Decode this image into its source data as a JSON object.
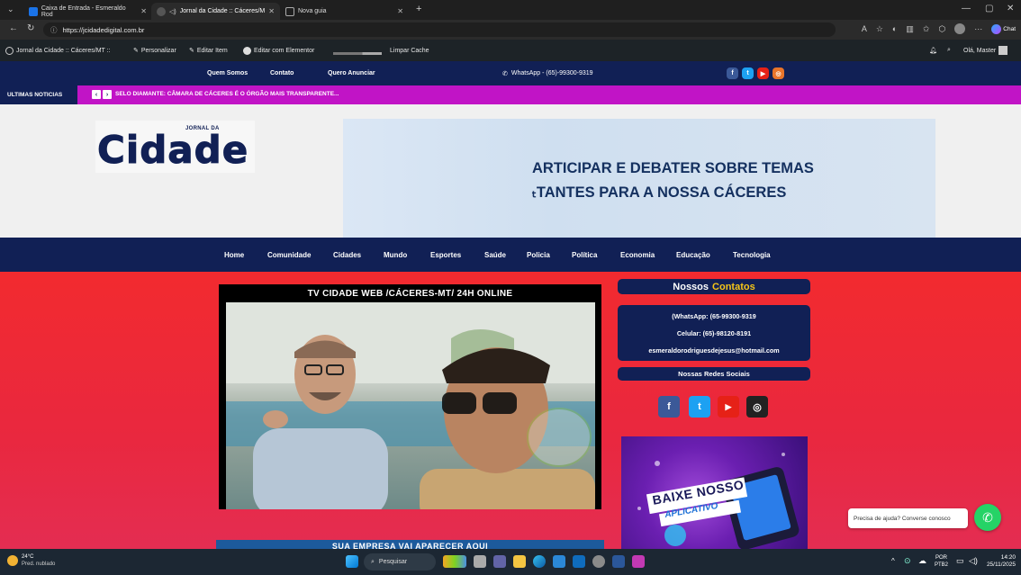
{
  "browser": {
    "tabs": [
      {
        "title": "Caixa de Entrada - Esmeraldo Rod",
        "active": false
      },
      {
        "title": "Jornal da Cidade :: Cáceres/M",
        "active": true
      },
      {
        "title": "Nova guia",
        "active": false
      }
    ],
    "url": "https://jcidadedigital.com.br",
    "profile_label": "Chat"
  },
  "wp_admin": {
    "site_name": "Jornal da Cidade :: Cáceres/MT ::",
    "customize": "Personalizar",
    "edit_item": "Editar Item",
    "edit_elementor": "Editar com Elementor",
    "clear_cache": "Limpar Cache",
    "greeting": "Olá, Master"
  },
  "topbar": {
    "links": [
      "Quem Somos",
      "Contato",
      "Quero Anunciar"
    ],
    "whatsapp": "WhatsApp - (65)-99300-9319"
  },
  "ticker": {
    "label": "ULTIMAS NOTICIAS",
    "headline": "SELO DIAMANTE: CÂMARA DE CÁCERES É O ÓRGÃO MAIS TRANSPARENTE..."
  },
  "header": {
    "logo_small": "JORNAL DA",
    "logo_big": "Cidade",
    "banner_line1": "ARTICIPAR E DEBATER SOBRE TEMAS",
    "banner_line2": "ₜTANTES PARA A NOSSA CÁCERES"
  },
  "main_nav": [
    "Home",
    "Comunidade",
    "Cidades",
    "Mundo",
    "Esportes",
    "Saúde",
    "Policia",
    "Política",
    "Economia",
    "Educação",
    "Tecnologia"
  ],
  "video": {
    "title": "TV CIDADE WEB /CÁCERES-MT/ 24H ONLINE"
  },
  "contacts": {
    "heading_white": "Nossos",
    "heading_accent": "Contatos",
    "whatsapp": "(WhatsApp: (65-99300-9319",
    "celular": "Celular: (65)-98120-8191",
    "email": "esmeraldorodriguesdejesus@hotmail.com",
    "social_heading": "Nossas Redes Sociais"
  },
  "app_promo": {
    "line1": "BAIXE NOSSO",
    "line2": "APLICATIVO"
  },
  "bottom_strip": "SUA EMPRESA VAI APARECER AQUI",
  "whatsapp_float": {
    "text": "Precisa de ajuda? Converse conosco"
  },
  "taskbar": {
    "temperature": "24°C",
    "weather": "Pred. nublado",
    "search": "Pesquisar",
    "lang": "POR",
    "lang2": "PTB2",
    "time": "14:20",
    "date": "25/11/2025"
  },
  "colors": {
    "navy": "#112055",
    "magenta": "#c114c6",
    "red": "#f22a2f",
    "accent_yellow": "#f5c518",
    "whatsapp_green": "#25d366"
  }
}
